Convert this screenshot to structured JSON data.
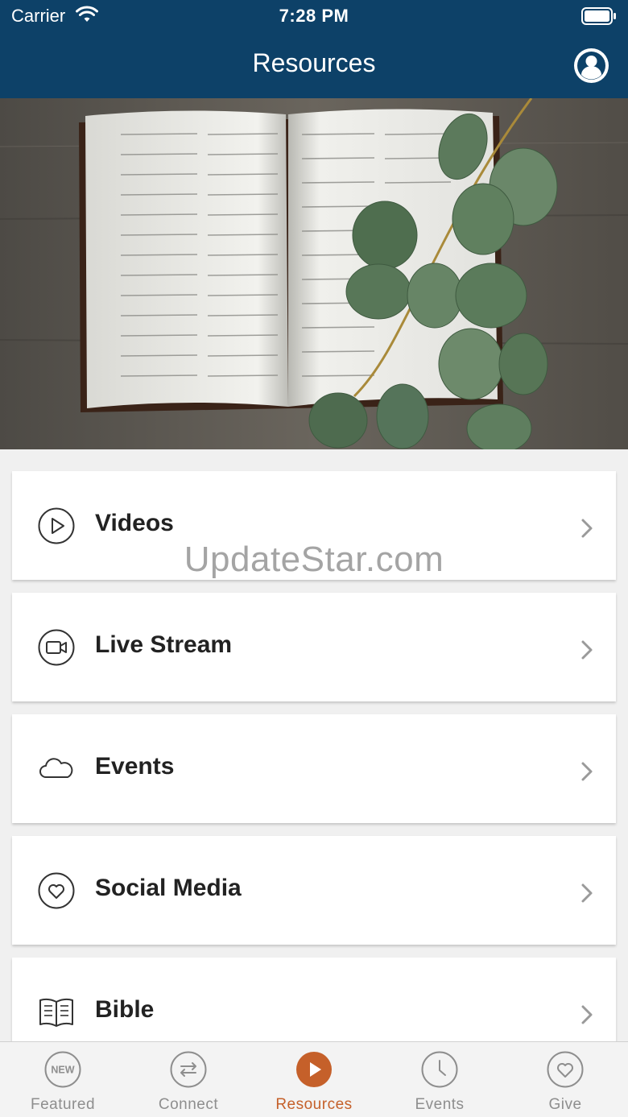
{
  "status_bar": {
    "carrier": "Carrier",
    "time": "7:28 PM"
  },
  "nav": {
    "title": "Resources",
    "profile_icon": "person-circle-icon"
  },
  "hero": {
    "image": "open-bible-with-eucalyptus-leaves-photo"
  },
  "menu": {
    "items": [
      {
        "label": "Videos",
        "icon": "play-circle-icon"
      },
      {
        "label": "Live Stream",
        "icon": "video-camera-circle-icon"
      },
      {
        "label": "Events",
        "icon": "cloud-icon"
      },
      {
        "label": "Social Media",
        "icon": "heart-circle-icon"
      },
      {
        "label": "Bible",
        "icon": "open-book-icon"
      }
    ]
  },
  "watermark": "UpdateStar.com",
  "tabs": {
    "items": [
      {
        "label": "Featured",
        "icon": "new-badge-icon",
        "badge": "NEW"
      },
      {
        "label": "Connect",
        "icon": "arrows-exchange-icon"
      },
      {
        "label": "Resources",
        "icon": "play-circle-filled-icon",
        "active": true
      },
      {
        "label": "Events",
        "icon": "clock-icon"
      },
      {
        "label": "Give",
        "icon": "heart-circle-icon"
      }
    ]
  },
  "colors": {
    "header": "#0d4168",
    "accent": "#c5602a",
    "inactive": "#8e8e8e"
  }
}
